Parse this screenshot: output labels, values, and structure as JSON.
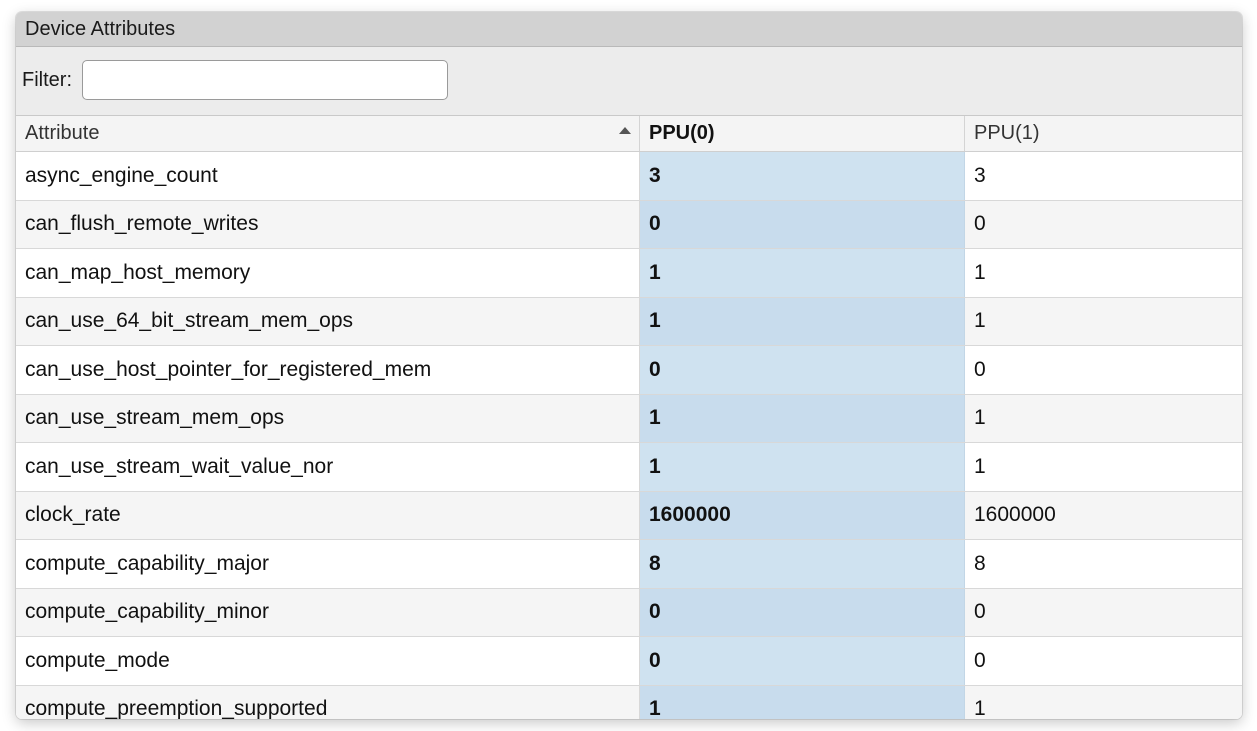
{
  "panel": {
    "title": "Device Attributes"
  },
  "filter": {
    "label": "Filter:",
    "value": "",
    "placeholder": ""
  },
  "table": {
    "columns": [
      "Attribute",
      "PPU(0)",
      "PPU(1)"
    ],
    "sorted_column": "Attribute",
    "sort_direction": "ascending",
    "highlighted_column": "PPU(0)",
    "rows": [
      {
        "attribute": "async_engine_count",
        "ppu0": "3",
        "ppu1": "3"
      },
      {
        "attribute": "can_flush_remote_writes",
        "ppu0": "0",
        "ppu1": "0"
      },
      {
        "attribute": "can_map_host_memory",
        "ppu0": "1",
        "ppu1": "1"
      },
      {
        "attribute": "can_use_64_bit_stream_mem_ops",
        "ppu0": "1",
        "ppu1": "1"
      },
      {
        "attribute": "can_use_host_pointer_for_registered_mem",
        "ppu0": "0",
        "ppu1": "0"
      },
      {
        "attribute": "can_use_stream_mem_ops",
        "ppu0": "1",
        "ppu1": "1"
      },
      {
        "attribute": "can_use_stream_wait_value_nor",
        "ppu0": "1",
        "ppu1": "1"
      },
      {
        "attribute": "clock_rate",
        "ppu0": "1600000",
        "ppu1": "1600000"
      },
      {
        "attribute": "compute_capability_major",
        "ppu0": "8",
        "ppu1": "8"
      },
      {
        "attribute": "compute_capability_minor",
        "ppu0": "0",
        "ppu1": "0"
      },
      {
        "attribute": "compute_mode",
        "ppu0": "0",
        "ppu1": "0"
      },
      {
        "attribute": "compute_preemption_supported",
        "ppu0": "1",
        "ppu1": "1"
      }
    ]
  },
  "colors": {
    "titlebar": "#d2d2d2",
    "panel_bg": "#ececec",
    "highlight_column": "#cfe2f0",
    "row_alt": "#f5f5f5"
  }
}
